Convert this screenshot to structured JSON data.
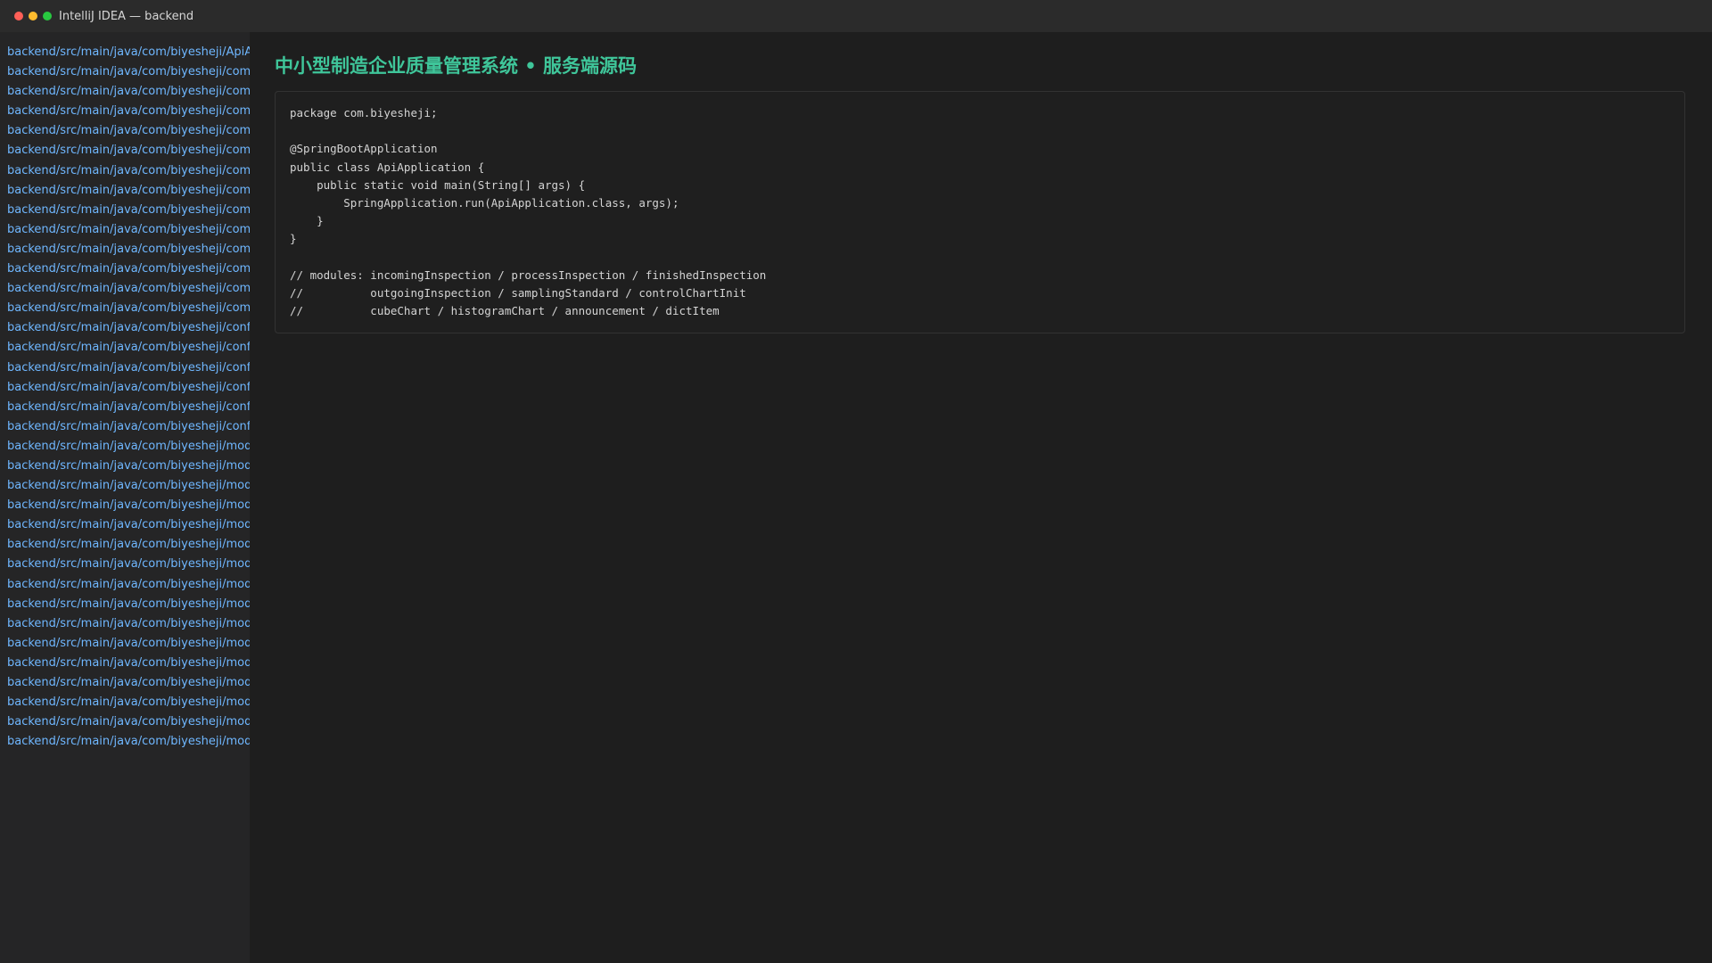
{
  "window": {
    "title": "IntelliJ IDEA — backend"
  },
  "sidebar": {
    "files": [
      "backend/src/main/java/com/biyesheji/ApiApplication.java",
      "backend/src/main/java/com/biyesheji/common",
      "backend/src/main/java/com/biyesheji/common",
      "backend/src/main/java/com/biyesheji/common",
      "backend/src/main/java/com/biyesheji/common",
      "backend/src/main/java/com/biyesheji/common",
      "backend/src/main/java/com/biyesheji/common",
      "backend/src/main/java/com/biyesheji/common",
      "backend/src/main/java/com/biyesheji/common",
      "backend/src/main/java/com/biyesheji/common",
      "backend/src/main/java/com/biyesheji/common",
      "backend/src/main/java/com/biyesheji/common",
      "backend/src/main/java/com/biyesheji/common",
      "backend/src/main/java/com/biyesheji/common",
      "backend/src/main/java/com/biyesheji/config",
      "backend/src/main/java/com/biyesheji/config",
      "backend/src/main/java/com/biyesheji/config",
      "backend/src/main/java/com/biyesheji/config",
      "backend/src/main/java/com/biyesheji/config",
      "backend/src/main/java/com/biyesheji/config",
      "backend/src/main/java/com/biyesheji/modules",
      "backend/src/main/java/com/biyesheji/modules",
      "backend/src/main/java/com/biyesheji/modules",
      "backend/src/main/java/com/biyesheji/modules",
      "backend/src/main/java/com/biyesheji/modules",
      "backend/src/main/java/com/biyesheji/modules",
      "backend/src/main/java/com/biyesheji/modules",
      "backend/src/main/java/com/biyesheji/modules",
      "backend/src/main/java/com/biyesheji/modules",
      "backend/src/main/java/com/biyesheji/modules",
      "backend/src/main/java/com/biyesheji/modules",
      "backend/src/main/java/com/biyesheji/modules",
      "backend/src/main/java/com/biyesheji/modules",
      "backend/src/main/java/com/biyesheji/modules",
      "backend/src/main/java/com/biyesheji/modules",
      "backend/src/main/java/com/biyesheji/modules"
    ]
  },
  "main": {
    "title": "中小型制造企业质量管理系统 • 服务端源码",
    "code_lines": [
      "package com.biyesheji;",
      "",
      "@SpringBootApplication",
      "public class ApiApplication {",
      "    public static void main(String[] args) {",
      "        SpringApplication.run(ApiApplication.class, args);",
      "    }",
      "}",
      "",
      "// modules: incomingInspection / processInspection / finishedInspection",
      "//          outgoingInspection / samplingStandard / controlChartInit",
      "//          cubeChart / histogramChart / announcement / dictItem"
    ]
  },
  "colors": {
    "accent_title": "#3fc69a",
    "file_link": "#6fb7ff",
    "background": "#1e1e1e",
    "sidebar_background": "#252526",
    "titlebar_background": "#2b2b2b"
  }
}
